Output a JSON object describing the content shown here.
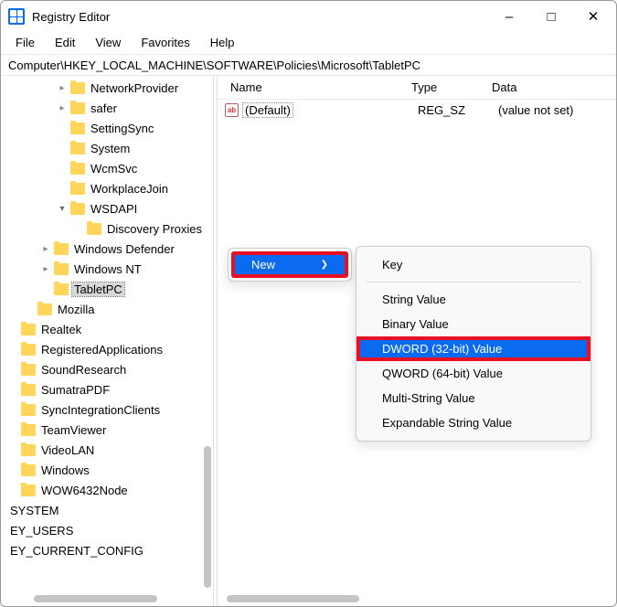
{
  "window": {
    "title": "Registry Editor"
  },
  "menubar": [
    "File",
    "Edit",
    "View",
    "Favorites",
    "Help"
  ],
  "addressbar": "Computer\\HKEY_LOCAL_MACHINE\\SOFTWARE\\Policies\\Microsoft\\TabletPC",
  "tree": [
    {
      "indent": 3,
      "exp": "c",
      "label": "NetworkProvider"
    },
    {
      "indent": 3,
      "exp": "c",
      "label": "safer"
    },
    {
      "indent": 3,
      "exp": "",
      "label": "SettingSync"
    },
    {
      "indent": 3,
      "exp": "",
      "label": "System"
    },
    {
      "indent": 3,
      "exp": "",
      "label": "WcmSvc"
    },
    {
      "indent": 3,
      "exp": "",
      "label": "WorkplaceJoin"
    },
    {
      "indent": 3,
      "exp": "e",
      "label": "WSDAPI"
    },
    {
      "indent": 4,
      "exp": "",
      "label": "Discovery Proxies"
    },
    {
      "indent": 2,
      "exp": "c",
      "label": "Windows Defender"
    },
    {
      "indent": 2,
      "exp": "c",
      "label": "Windows NT"
    },
    {
      "indent": 2,
      "exp": "",
      "label": "TabletPC",
      "selected": true
    },
    {
      "indent": 1,
      "exp": "",
      "label": "Mozilla"
    },
    {
      "indent": 0,
      "exp": "",
      "label": "Realtek"
    },
    {
      "indent": 0,
      "exp": "",
      "label": "RegisteredApplications"
    },
    {
      "indent": 0,
      "exp": "",
      "label": "SoundResearch"
    },
    {
      "indent": 0,
      "exp": "",
      "label": "SumatraPDF"
    },
    {
      "indent": 0,
      "exp": "",
      "label": "SyncIntegrationClients"
    },
    {
      "indent": 0,
      "exp": "",
      "label": "TeamViewer"
    },
    {
      "indent": 0,
      "exp": "",
      "label": "VideoLAN"
    },
    {
      "indent": 0,
      "exp": "",
      "label": "Windows"
    },
    {
      "indent": 0,
      "exp": "",
      "label": "WOW6432Node"
    },
    {
      "indent": -1,
      "exp": "",
      "label": "SYSTEM",
      "nofolder": true
    },
    {
      "indent": -1,
      "exp": "",
      "label": "EY_USERS",
      "nofolder": true
    },
    {
      "indent": -1,
      "exp": "",
      "label": "EY_CURRENT_CONFIG",
      "nofolder": true
    }
  ],
  "columns": {
    "name": "Name",
    "type": "Type",
    "data": "Data"
  },
  "values": [
    {
      "icon": "ab",
      "name": "(Default)",
      "type": "REG_SZ",
      "data": "(value not set)"
    }
  ],
  "context": {
    "new": "New"
  },
  "submenu": [
    {
      "label": "Key"
    },
    {
      "sep": true
    },
    {
      "label": "String Value"
    },
    {
      "label": "Binary Value"
    },
    {
      "label": "DWORD (32-bit) Value",
      "highlight": true
    },
    {
      "label": "QWORD (64-bit) Value"
    },
    {
      "label": "Multi-String Value"
    },
    {
      "label": "Expandable String Value"
    }
  ]
}
